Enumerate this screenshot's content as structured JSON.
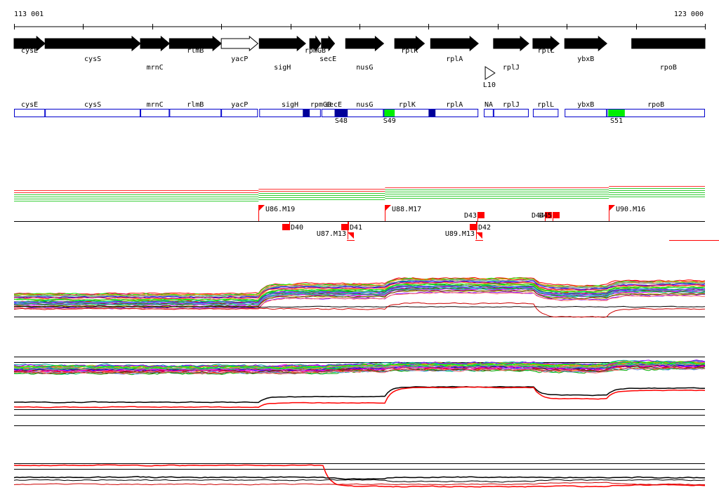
{
  "coords": {
    "start_label": "113 001",
    "end_label": "123 000",
    "start": 113001,
    "end": 123000
  },
  "colors": {
    "gene_fill": "#000000",
    "gene_hollow": "#ffffff",
    "box_border": "#0000cc",
    "box_dark": "#000099",
    "box_green": "#00ee00",
    "marker_red": "#ff0000",
    "line_black": "#000000"
  },
  "genes": [
    {
      "label": "cysE",
      "start": 113001,
      "end": 113450,
      "dir": "+",
      "filled": true,
      "row": 0
    },
    {
      "label": "cysS",
      "start": 113450,
      "end": 114830,
      "dir": "+",
      "filled": true,
      "row": 1
    },
    {
      "label": "mrnC",
      "start": 114830,
      "end": 115250,
      "dir": "+",
      "filled": true,
      "row": 2
    },
    {
      "label": "rlmB",
      "start": 115250,
      "end": 116000,
      "dir": "+",
      "filled": true,
      "row": 0
    },
    {
      "label": "yacP",
      "start": 116000,
      "end": 116530,
      "dir": "+",
      "filled": false,
      "row": 1
    },
    {
      "label": "sigH",
      "start": 116550,
      "end": 117220,
      "dir": "+",
      "filled": true,
      "row": 2
    },
    {
      "label": "rpmGB",
      "start": 117280,
      "end": 117440,
      "dir": "+",
      "filled": true,
      "row": 0
    },
    {
      "label": "secE",
      "start": 117450,
      "end": 117640,
      "dir": "+",
      "filled": true,
      "row": 1
    },
    {
      "label": "nusG",
      "start": 117800,
      "end": 118350,
      "dir": "+",
      "filled": true,
      "row": 2
    },
    {
      "label": "rplK",
      "start": 118510,
      "end": 118940,
      "dir": "+",
      "filled": true,
      "row": 0
    },
    {
      "label": "rplA",
      "start": 119030,
      "end": 119720,
      "dir": "+",
      "filled": true,
      "row": 1
    },
    {
      "label": "rplJ",
      "start": 119940,
      "end": 120450,
      "dir": "+",
      "filled": true,
      "row": 2
    },
    {
      "label": "rplL",
      "start": 120510,
      "end": 120890,
      "dir": "+",
      "filled": true,
      "row": 0
    },
    {
      "label": "ybxB",
      "start": 120970,
      "end": 121580,
      "dir": "+",
      "filled": true,
      "row": 1
    },
    {
      "label": "rpoB",
      "start": 121940,
      "end": 123000,
      "dir": "+",
      "filled": true,
      "row": 2
    }
  ],
  "small_feature": {
    "label": "L10",
    "start": 119820,
    "end": 119960
  },
  "boxes": [
    {
      "label": "cysE",
      "start": 113001,
      "end": 113450
    },
    {
      "label": "cysS",
      "start": 113450,
      "end": 114830
    },
    {
      "label": "mrnC",
      "start": 114830,
      "end": 115250
    },
    {
      "label": "rlmB",
      "start": 115250,
      "end": 116000
    },
    {
      "label": "yacP",
      "start": 116000,
      "end": 116530
    },
    {
      "label": "sigH",
      "start": 116550,
      "end": 117440
    },
    {
      "label": "rpmGB",
      "start": 117440,
      "end": 117440
    },
    {
      "label": "secE",
      "start": 117450,
      "end": 117800
    },
    {
      "label": "nusG",
      "start": 117800,
      "end": 118350
    },
    {
      "label": "rplK",
      "start": 118350,
      "end": 119030
    },
    {
      "label": "rplA",
      "start": 119030,
      "end": 119720
    },
    {
      "label": "NA",
      "start": 119800,
      "end": 119940
    },
    {
      "label": "rplJ",
      "start": 119940,
      "end": 120450
    },
    {
      "label": "rplL",
      "start": 120510,
      "end": 120880
    },
    {
      "label": "ybxB",
      "start": 120970,
      "end": 121580
    },
    {
      "label": "rpoB",
      "start": 121580,
      "end": 123000
    }
  ],
  "box_marks": [
    {
      "start": 117180,
      "end": 117280,
      "color": "dark",
      "label": ""
    },
    {
      "start": 117640,
      "end": 117830,
      "color": "dark",
      "label": "S48"
    },
    {
      "start": 118360,
      "end": 118510,
      "color": "green",
      "label": "S49"
    },
    {
      "start": 119000,
      "end": 119100,
      "color": "dark",
      "label": ""
    },
    {
      "start": 121600,
      "end": 121840,
      "color": "green",
      "label": "S51"
    }
  ],
  "features": [
    {
      "label": "U86.M19",
      "pos": 116540,
      "kind": "flag",
      "side": "up"
    },
    {
      "label": "U88.M17",
      "pos": 118370,
      "kind": "flag",
      "side": "up"
    },
    {
      "label": "U90.M16",
      "pos": 121610,
      "kind": "flag",
      "side": "up"
    },
    {
      "label": "D43",
      "pos": 119710,
      "kind": "block",
      "side": "up"
    },
    {
      "label": "D44",
      "pos": 120680,
      "kind": "block",
      "side": "up"
    },
    {
      "label": "D45",
      "pos": 120790,
      "kind": "block",
      "side": "up"
    },
    {
      "label": "D40",
      "pos": 116980,
      "kind": "block",
      "side": "down"
    },
    {
      "label": "D41",
      "pos": 117840,
      "kind": "block",
      "side": "down"
    },
    {
      "label": "U87.M13",
      "pos": 117830,
      "kind": "flag",
      "side": "down"
    },
    {
      "label": "D42",
      "pos": 119700,
      "kind": "block",
      "side": "down"
    },
    {
      "label": "U89.M13",
      "pos": 119690,
      "kind": "flag",
      "side": "down"
    }
  ]
}
